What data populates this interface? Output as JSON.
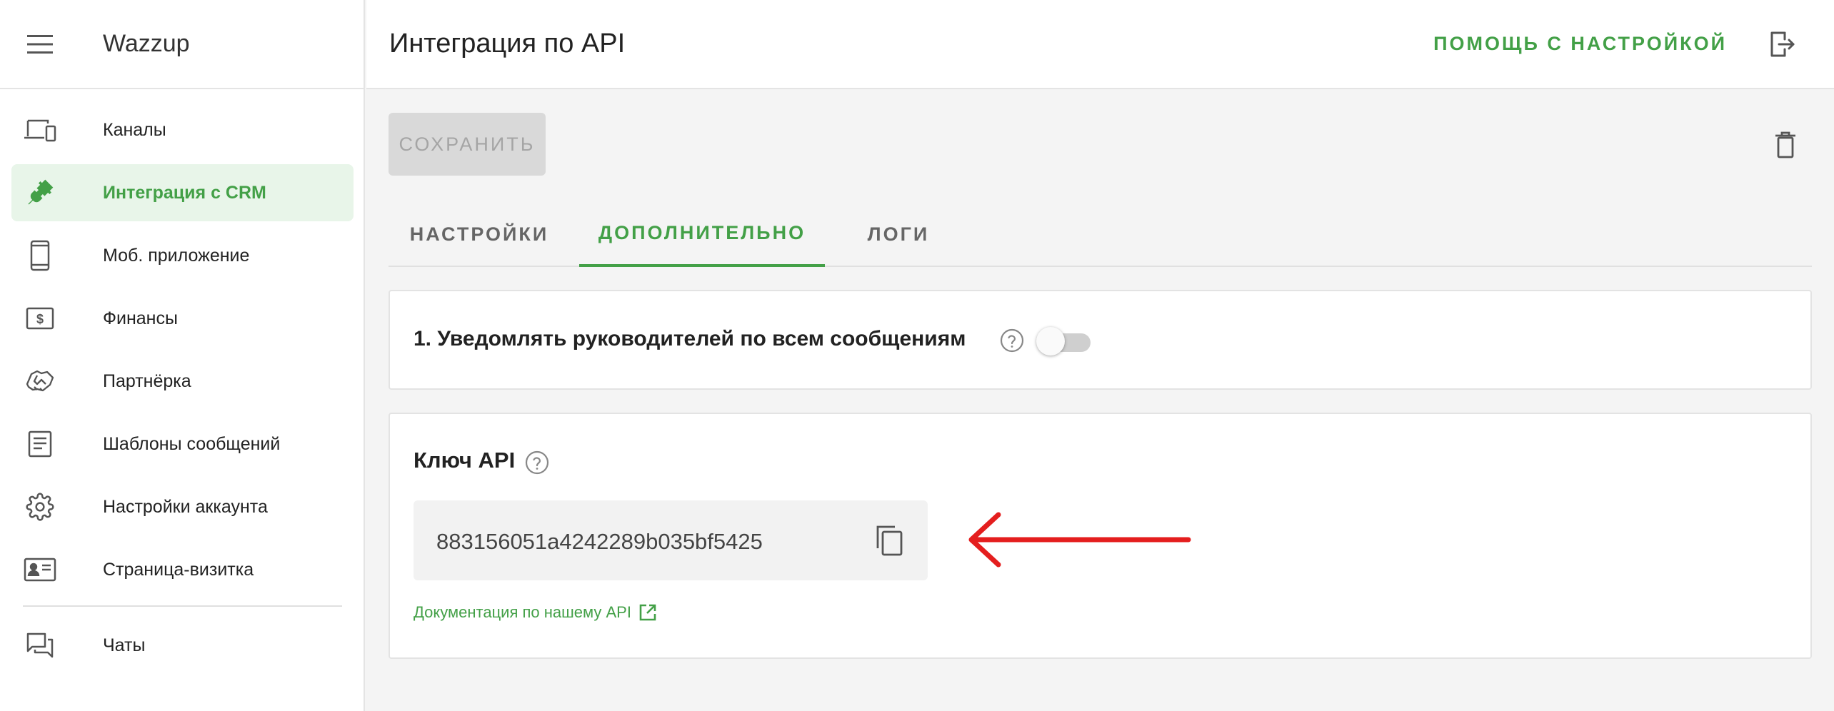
{
  "app": {
    "name": "Wazzup"
  },
  "header": {
    "title": "Интеграция по API",
    "help_label": "ПОМОЩЬ С НАСТРОЙКОЙ"
  },
  "sidebar": {
    "items": [
      {
        "label": "Каналы",
        "icon": "devices-icon",
        "active": false
      },
      {
        "label": "Интеграция с CRM",
        "icon": "plug-icon",
        "active": true
      },
      {
        "label": "Моб. приложение",
        "icon": "phone-icon",
        "active": false
      },
      {
        "label": "Финансы",
        "icon": "dollar-icon",
        "active": false
      },
      {
        "label": "Партнёрка",
        "icon": "handshake-icon",
        "active": false
      },
      {
        "label": "Шаблоны сообщений",
        "icon": "document-icon",
        "active": false
      },
      {
        "label": "Настройки аккаунта",
        "icon": "gear-icon",
        "active": false
      },
      {
        "label": "Страница-визитка",
        "icon": "id-card-icon",
        "active": false
      }
    ],
    "bottom_item": {
      "label": "Чаты",
      "icon": "chat-icon"
    }
  },
  "toolbar": {
    "save_label": "СОХРАНИТЬ"
  },
  "tabs": [
    {
      "label": "НАСТРОЙКИ",
      "active": false
    },
    {
      "label": "ДОПОЛНИТЕЛЬНО",
      "active": true
    },
    {
      "label": "ЛОГИ",
      "active": false
    }
  ],
  "notify": {
    "label": "1. Уведомлять руководителей по всем сообщениям",
    "enabled": false
  },
  "api_key": {
    "label": "Ключ API",
    "value": "883156051a4242289b035bf5425",
    "doc_link": "Документация по нашему API"
  },
  "colors": {
    "accent": "#43a047",
    "active_bg": "#e8f5e9",
    "arrow": "#e41e1e"
  }
}
